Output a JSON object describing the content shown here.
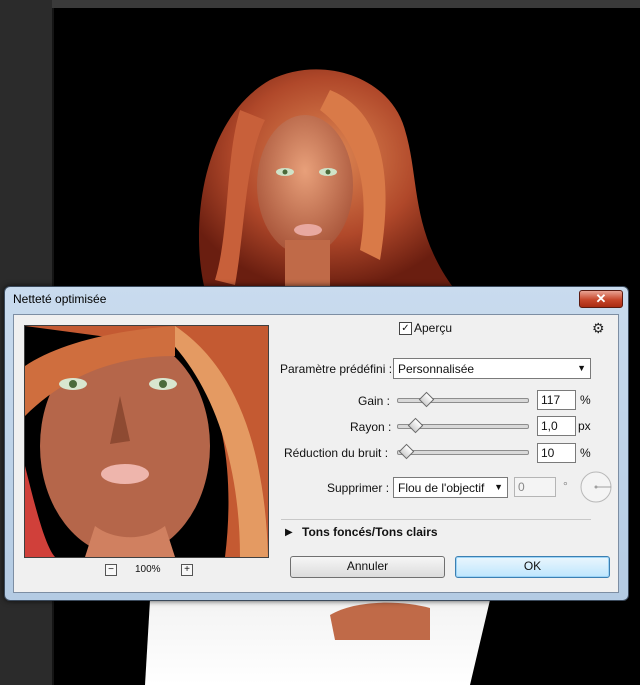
{
  "dialog": {
    "title": "Netteté optimisée",
    "close_label": "✕"
  },
  "preview": {
    "zoom_out_label": "−",
    "zoom_level": "100%",
    "zoom_in_label": "+"
  },
  "apercu": {
    "label": "Aperçu",
    "checked": "✓"
  },
  "preset": {
    "label": "Paramètre prédéfini :",
    "value": "Personnalisée"
  },
  "sliders": {
    "gain": {
      "label": "Gain :",
      "value": "117",
      "unit": "%",
      "level": 0.22
    },
    "rayon": {
      "label": "Rayon :",
      "value": "1,0",
      "unit": "px",
      "level": 0.14
    },
    "bruit": {
      "label": "Réduction du bruit :",
      "value": "10",
      "unit": "%",
      "level": 0.07
    }
  },
  "supprimer": {
    "label": "Supprimer :",
    "value": "Flou de l'objectif",
    "angle_value": "0",
    "degree": "°"
  },
  "section": {
    "title": "Tons foncés/Tons clairs"
  },
  "buttons": {
    "cancel": "Annuler",
    "ok": "OK"
  },
  "colors": {
    "dialog_frame": "#b4cbe3",
    "client_bg": "#f0f0f0",
    "close_red": "#c7462b",
    "ok_blue": "#bee6fd"
  }
}
